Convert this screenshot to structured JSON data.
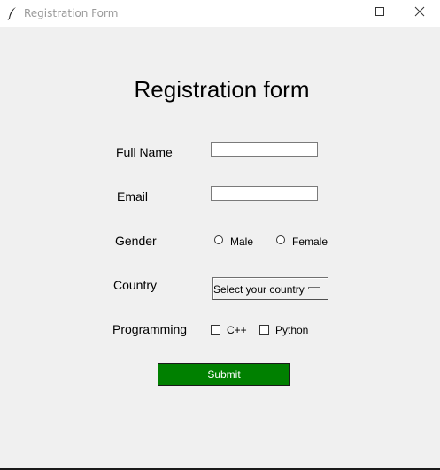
{
  "window": {
    "title": "Registration Form",
    "app_icon": "feather-icon",
    "controls": [
      "minimize-icon",
      "maximize-icon",
      "close-icon"
    ]
  },
  "form": {
    "heading": "Registration form",
    "full_name": {
      "label": "Full Name",
      "value": ""
    },
    "email": {
      "label": "Email",
      "value": ""
    },
    "gender": {
      "label": "Gender",
      "options": [
        "Male",
        "Female"
      ],
      "selected": null
    },
    "country": {
      "label": "Country",
      "selected": "Select your country"
    },
    "programming": {
      "label": "Programming",
      "options": [
        "C++",
        "Python"
      ],
      "checked": []
    },
    "submit_label": "Submit",
    "submit_color": "#008000"
  }
}
